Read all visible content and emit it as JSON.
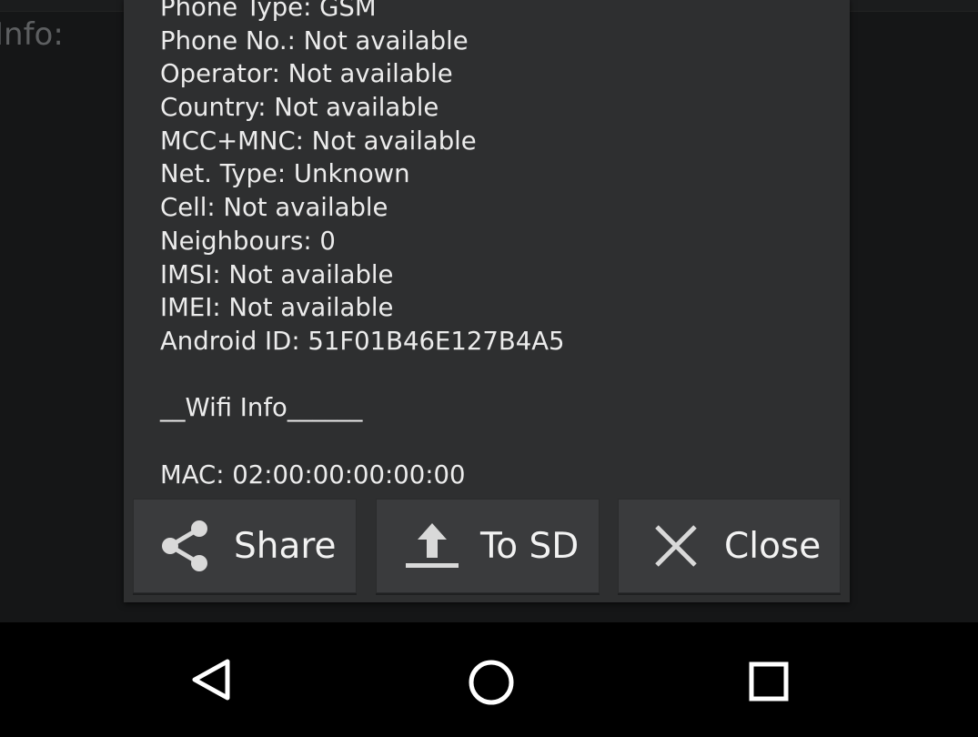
{
  "background": {
    "label": "Info:"
  },
  "dialog": {
    "lines": [
      "Phone Type: GSM",
      "Phone No.: Not available",
      "Operator: Not available",
      "Country: Not available",
      "MCC+MNC: Not available",
      "Net. Type: Unknown",
      "Cell: Not available",
      "Neighbours: 0",
      "IMSI: Not available",
      "IMEI: Not available",
      "Android ID: 51F01B46E127B4A5",
      "",
      "__Wifi Info______",
      "",
      "MAC: 02:00:00:00:00:00"
    ],
    "buttons": {
      "share": {
        "label": "Share",
        "icon": "share-icon"
      },
      "to_sd": {
        "label": "To SD",
        "icon": "upload-icon"
      },
      "close": {
        "label": "Close",
        "icon": "close-icon"
      }
    }
  },
  "navbar": {
    "back_icon": "back-triangle-icon",
    "home_icon": "home-circle-icon",
    "recent_icon": "recent-apps-square-icon"
  },
  "colors": {
    "dialog_bg": "#2e2f30",
    "button_bg": "#3a3b3d",
    "text": "#ececec",
    "navbar_bg": "#000000"
  }
}
